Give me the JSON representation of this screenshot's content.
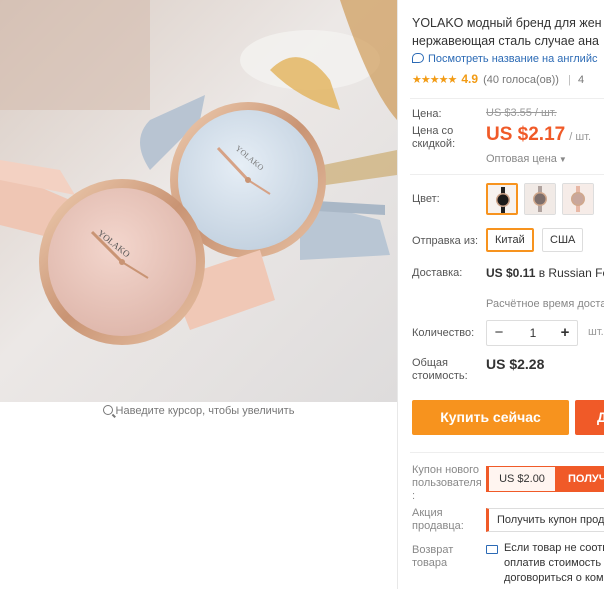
{
  "photo": {
    "brand_left": "YOLAKO",
    "brand_right": "YOLAKO",
    "zoom_hint": "Наведите курсор, чтобы увеличить"
  },
  "product": {
    "title_line1": "YOLAKO модный бренд для жен",
    "title_line2": "нержавеющая сталь случае ана",
    "translate_link": "Посмотреть название на английс",
    "stars": "★★★★★",
    "rating": "4.9",
    "votes": "(40 голоса(ов))",
    "rating_more": "4"
  },
  "price": {
    "label_price": "Цена:",
    "old_price": "US $3.55 / шт.",
    "label_discount": "Цена со скидкой:",
    "new_price": "US $2.17",
    "unit": "/ шт.",
    "wholesale": "Оптовая цена",
    "wholesale_caret": "▼"
  },
  "options": {
    "color_label": "Цвет:",
    "ship_from_label": "Отправка из:",
    "ship_from": [
      "Китай",
      "США"
    ]
  },
  "delivery": {
    "label": "Доставка:",
    "price": "US $0.11",
    "destination": "в Russian Fed",
    "time": "Расчётное время достав"
  },
  "quantity": {
    "label": "Количество:",
    "minus": "−",
    "value": "1",
    "plus": "+",
    "unit": "шт. ("
  },
  "total": {
    "label": "Общая стоимость:",
    "value": "US $2.28"
  },
  "actions": {
    "buy_now": "Купить сейчас",
    "add_to_cart": "Д"
  },
  "coupons": {
    "new_user_label": "Купон нового пользователя :",
    "new_user_value": "US $2.00",
    "new_user_button": "ПОЛУЧ",
    "seller_label": "Акция продавца:",
    "seller_value": "Получить купон прод",
    "return_label": "Возврат товара",
    "return_line1": "Если товар не соотв",
    "return_line2": "оплатив стоимость е",
    "return_line3": "договориться о комп"
  },
  "colors": {
    "accent_orange": "#f7931e",
    "price_red": "#f05a28",
    "link_blue": "#2b6ab5",
    "star": "#f29b14"
  }
}
